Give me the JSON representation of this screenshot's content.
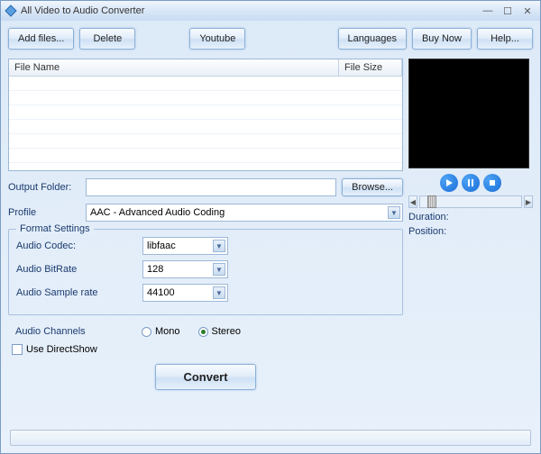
{
  "title": "All Video to Audio Converter",
  "toolbar": {
    "add_files": "Add files...",
    "delete": "Delete",
    "youtube": "Youtube",
    "languages": "Languages",
    "buy_now": "Buy Now",
    "help": "Help..."
  },
  "table": {
    "col_name": "File Name",
    "col_size": "File Size"
  },
  "output": {
    "label": "Output Folder:",
    "value": "",
    "browse": "Browse..."
  },
  "profile": {
    "label": "Profile",
    "value": "AAC - Advanced Audio Coding"
  },
  "format": {
    "legend": "Format Settings",
    "codec_label": "Audio Codec:",
    "codec_value": "libfaac",
    "bitrate_label": "Audio BitRate",
    "bitrate_value": "128",
    "sample_label": "Audio Sample rate",
    "sample_value": "44100"
  },
  "channels": {
    "label": "Audio Channels",
    "mono": "Mono",
    "stereo": "Stereo"
  },
  "directshow": "Use DirectShow",
  "convert": "Convert",
  "preview": {
    "duration": "Duration:",
    "position": "Position:"
  }
}
